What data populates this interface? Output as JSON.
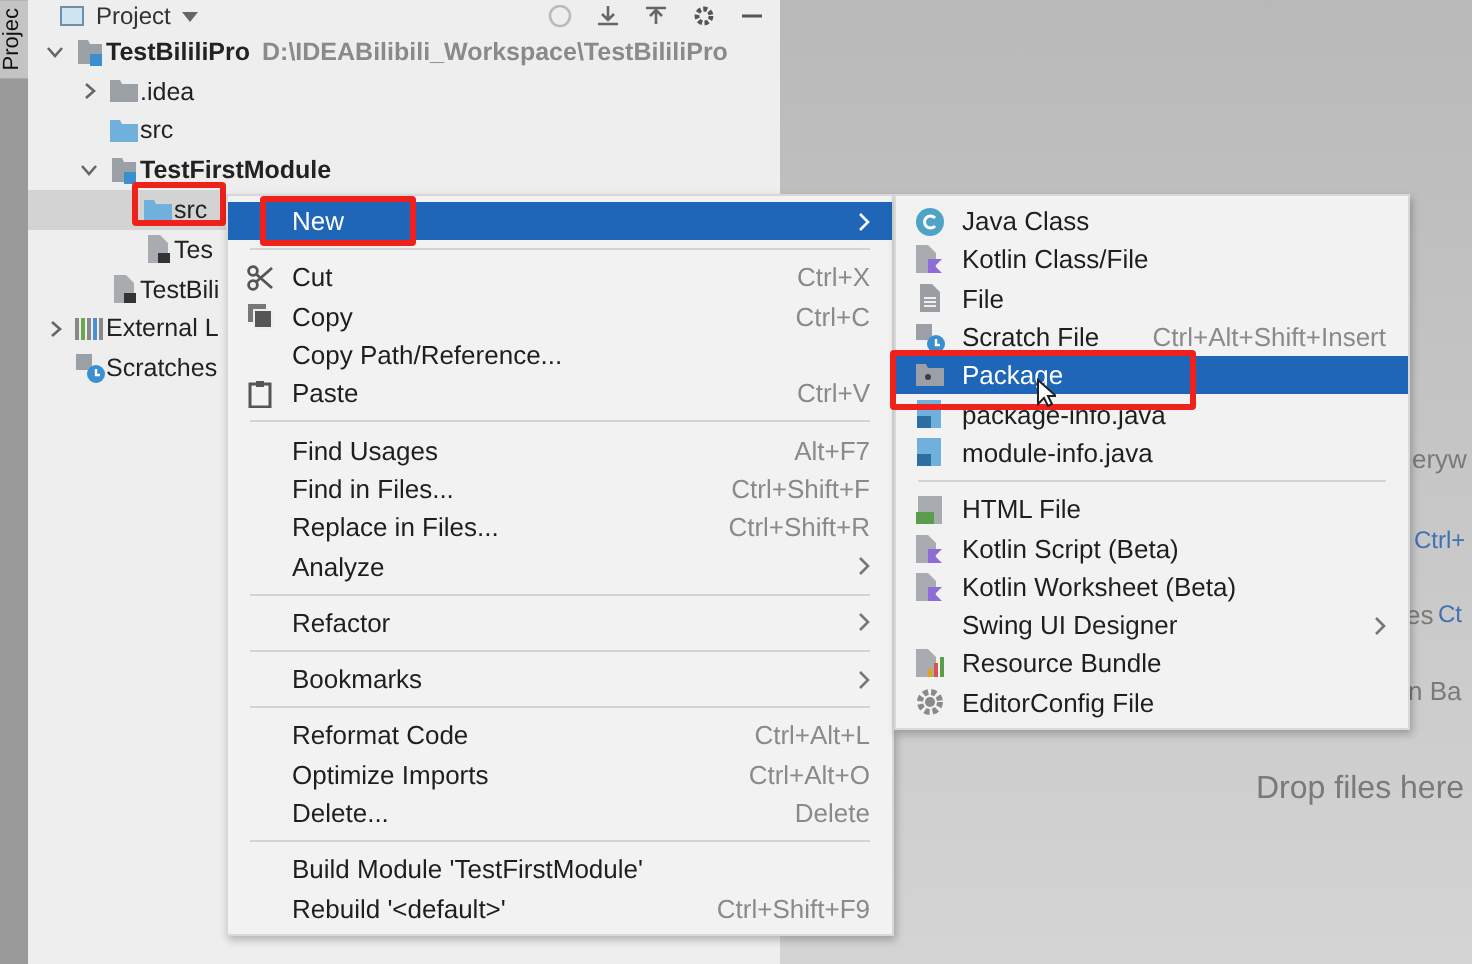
{
  "side_tab": {
    "label": "Projec"
  },
  "project_panel": {
    "title": "Project",
    "tree": [
      {
        "label": "TestBililiPro",
        "kind": "module",
        "bold": true,
        "path": "D:\\IDEABilibili_Workspace\\TestBililiPro",
        "expanded": true,
        "selected": false,
        "children": [
          {
            "label": ".idea",
            "kind": "folder",
            "expanded": false,
            "selected": false
          },
          {
            "label": "src",
            "kind": "source_folder",
            "selected": false
          },
          {
            "label": "TestFirstModule",
            "kind": "module",
            "bold": true,
            "expanded": true,
            "selected": false,
            "children": [
              {
                "label": "src",
                "kind": "source_folder",
                "selected": true,
                "highlighted": true
              },
              {
                "label": "Tes",
                "kind": "file",
                "selected": false
              }
            ]
          },
          {
            "label": "TestBili",
            "kind": "file",
            "selected": false
          }
        ]
      },
      {
        "label": "External L",
        "kind": "library",
        "expanded": false,
        "selected": false
      },
      {
        "label": "Scratches",
        "kind": "scratches",
        "selected": false
      }
    ]
  },
  "editor_hints": [
    {
      "text": "eryw",
      "kind": "plain"
    },
    {
      "text": "Ctrl+",
      "kind": "shortcut"
    },
    {
      "text": "es",
      "kind": "plain"
    },
    {
      "text": "Ct",
      "kind": "shortcut"
    },
    {
      "text": "n Ba",
      "kind": "plain"
    },
    {
      "text": "Drop files here",
      "kind": "plain"
    }
  ],
  "context_menu": {
    "items": [
      {
        "kind": "item",
        "label": "New",
        "has_submenu": true,
        "selected": true,
        "highlighted": true
      },
      {
        "kind": "separator"
      },
      {
        "kind": "item",
        "label": "Cut",
        "shortcut": "Ctrl+X",
        "selected": false
      },
      {
        "kind": "item",
        "label": "Copy",
        "shortcut": "Ctrl+C",
        "selected": false
      },
      {
        "kind": "item",
        "label": "Copy Path/Reference...",
        "selected": false
      },
      {
        "kind": "item",
        "label": "Paste",
        "shortcut": "Ctrl+V",
        "selected": false
      },
      {
        "kind": "separator"
      },
      {
        "kind": "item",
        "label": "Find Usages",
        "shortcut": "Alt+F7",
        "selected": false
      },
      {
        "kind": "item",
        "label": "Find in Files...",
        "shortcut": "Ctrl+Shift+F",
        "selected": false
      },
      {
        "kind": "item",
        "label": "Replace in Files...",
        "shortcut": "Ctrl+Shift+R",
        "selected": false
      },
      {
        "kind": "item",
        "label": "Analyze",
        "has_submenu": true,
        "selected": false
      },
      {
        "kind": "separator"
      },
      {
        "kind": "item",
        "label": "Refactor",
        "has_submenu": true,
        "selected": false
      },
      {
        "kind": "separator"
      },
      {
        "kind": "item",
        "label": "Bookmarks",
        "has_submenu": true,
        "selected": false
      },
      {
        "kind": "separator"
      },
      {
        "kind": "item",
        "label": "Reformat Code",
        "shortcut": "Ctrl+Alt+L",
        "selected": false
      },
      {
        "kind": "item",
        "label": "Optimize Imports",
        "shortcut": "Ctrl+Alt+O",
        "selected": false
      },
      {
        "kind": "item",
        "label": "Delete...",
        "shortcut": "Delete",
        "selected": false
      },
      {
        "kind": "separator"
      },
      {
        "kind": "item",
        "label": "Build Module 'TestFirstModule'",
        "selected": false
      },
      {
        "kind": "item",
        "label": "Rebuild '<default>'",
        "shortcut": "Ctrl+Shift+F9",
        "selected": false
      }
    ]
  },
  "new_submenu": {
    "items": [
      {
        "kind": "item",
        "label": "Java Class",
        "selected": false
      },
      {
        "kind": "item",
        "label": "Kotlin Class/File",
        "selected": false
      },
      {
        "kind": "item",
        "label": "File",
        "selected": false
      },
      {
        "kind": "item",
        "label": "Scratch File",
        "shortcut": "Ctrl+Alt+Shift+Insert",
        "selected": false
      },
      {
        "kind": "item",
        "label": "Package",
        "selected": true,
        "highlighted": true
      },
      {
        "kind": "item",
        "label": "package-info.java",
        "selected": false
      },
      {
        "kind": "item",
        "label": "module-info.java",
        "selected": false
      },
      {
        "kind": "separator"
      },
      {
        "kind": "item",
        "label": "HTML File",
        "selected": false
      },
      {
        "kind": "item",
        "label": "Kotlin Script (Beta)",
        "selected": false
      },
      {
        "kind": "item",
        "label": "Kotlin Worksheet (Beta)",
        "selected": false
      },
      {
        "kind": "item",
        "label": "Swing UI Designer",
        "has_submenu": true,
        "selected": false
      },
      {
        "kind": "item",
        "label": "Resource Bundle",
        "selected": false
      },
      {
        "kind": "item",
        "label": "EditorConfig File",
        "selected": false
      }
    ]
  }
}
